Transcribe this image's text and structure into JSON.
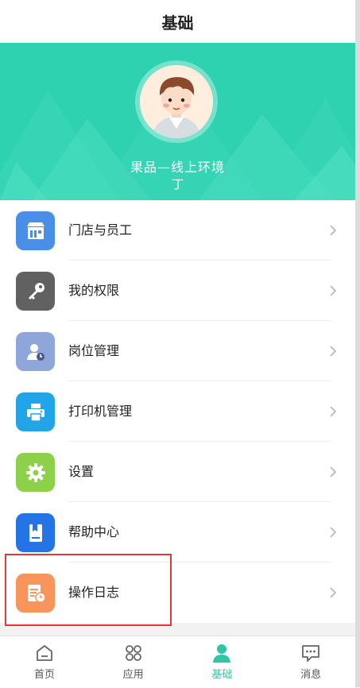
{
  "header": {
    "title": "基础"
  },
  "profile": {
    "name": "果品—线上环境",
    "subtitle": "丁"
  },
  "menu": {
    "items": [
      {
        "label": "门店与员工",
        "icon": "store-icon",
        "color": "#4a8fe7"
      },
      {
        "label": "我的权限",
        "icon": "key-icon",
        "color": "#616161"
      },
      {
        "label": "岗位管理",
        "icon": "user-role-icon",
        "color": "#8ea6d9"
      },
      {
        "label": "打印机管理",
        "icon": "printer-icon",
        "color": "#21a5e8"
      },
      {
        "label": "设置",
        "icon": "gear-icon",
        "color": "#8dd14a"
      },
      {
        "label": "帮助中心",
        "icon": "book-icon",
        "color": "#2474e6"
      },
      {
        "label": "操作日志",
        "icon": "log-icon",
        "color": "#f7955c"
      }
    ]
  },
  "tabbar": {
    "tabs": [
      {
        "label": "首页",
        "icon": "home-icon"
      },
      {
        "label": "应用",
        "icon": "apps-icon"
      },
      {
        "label": "基础",
        "icon": "person-icon",
        "active": true
      },
      {
        "label": "消息",
        "icon": "message-icon"
      }
    ]
  },
  "colors": {
    "accent": "#2ed1b0",
    "tab_active": "#2ec6a4",
    "highlight": "#e5383b"
  }
}
